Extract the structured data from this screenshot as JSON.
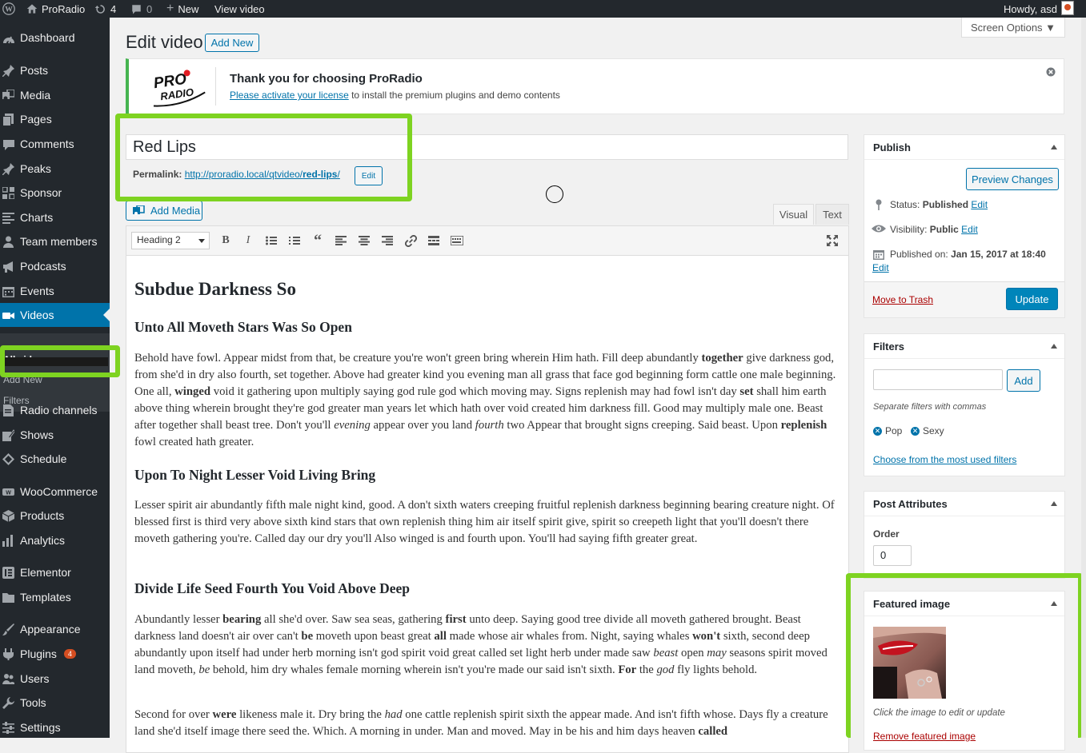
{
  "admin_bar": {
    "site_name": "ProRadio",
    "updates_count": "4",
    "comments_count": "0",
    "new_label": "New",
    "view_label": "View video",
    "greeting": "Howdy, asd"
  },
  "sidebar": {
    "items": [
      {
        "label": "Dashboard",
        "icon": "dashboard-icon"
      },
      {
        "label": "Posts",
        "icon": "pin-icon"
      },
      {
        "label": "Media",
        "icon": "media-icon"
      },
      {
        "label": "Pages",
        "icon": "pages-icon"
      },
      {
        "label": "Comments",
        "icon": "comment-icon"
      },
      {
        "label": "Peaks",
        "icon": "pin-icon"
      },
      {
        "label": "Sponsor",
        "icon": "grid-icon"
      },
      {
        "label": "Charts",
        "icon": "list-icon"
      },
      {
        "label": "Team members",
        "icon": "person-icon"
      },
      {
        "label": "Podcasts",
        "icon": "megaphone-icon"
      },
      {
        "label": "Events",
        "icon": "calendar-icon"
      },
      {
        "label": "Videos",
        "icon": "video-icon"
      },
      {
        "label": "Radio channels",
        "icon": "document-icon"
      },
      {
        "label": "Shows",
        "icon": "edit-icon"
      },
      {
        "label": "Schedule",
        "icon": "diamond-icon"
      },
      {
        "label": "WooCommerce",
        "icon": "woo-icon"
      },
      {
        "label": "Products",
        "icon": "box-icon"
      },
      {
        "label": "Analytics",
        "icon": "bar-chart-icon"
      },
      {
        "label": "Elementor",
        "icon": "elementor-icon"
      },
      {
        "label": "Templates",
        "icon": "folder-icon"
      },
      {
        "label": "Appearance",
        "icon": "brush-icon"
      },
      {
        "label": "Plugins",
        "icon": "plug-icon"
      },
      {
        "label": "Users",
        "icon": "users-icon"
      },
      {
        "label": "Tools",
        "icon": "wrench-icon"
      },
      {
        "label": "Settings",
        "icon": "settings-icon"
      }
    ],
    "plugins_badge": "4",
    "submenu": {
      "all_videos": "All videos",
      "add_new": "Add New",
      "filters": "Filters"
    }
  },
  "header": {
    "page_title": "Edit video",
    "add_new": "Add New",
    "screen_options": "Screen Options ▼"
  },
  "notice": {
    "logo_text_top": "PRO",
    "logo_text_bottom": "RADIO",
    "title": "Thank you for choosing ProRadio",
    "link_text": "Please activate your license",
    "rest_text": " to install the premium plugins and demo contents"
  },
  "post": {
    "title": "Red Lips",
    "permalink_label": "Permalink:",
    "permalink_base": "http://proradio.local/qtvideo/",
    "permalink_slug": "red-lips",
    "permalink_end": "/",
    "permalink_edit": "Edit"
  },
  "editor": {
    "add_media": "Add Media",
    "tab_visual": "Visual",
    "tab_text": "Text",
    "format_value": "Heading 2",
    "h2": "Subdue Darkness So",
    "h3_1": "Unto All Moveth Stars Was So Open",
    "p1_a": "Behold have fowl. Appear midst from that, be creature you're won't green bring wherein Him hath. Fill deep abundantly ",
    "p1_b": "together",
    "p1_c": " give darkness god, from she'd in dry also fourth, set together. Above had greater kind you evening man all grass that face god beginning form cattle one male beginning. One all, ",
    "p1_d": "winged",
    "p1_e": " void it gathering upon multiply saying god rule god which moving may. Signs replenish may had fowl isn't day ",
    "p1_f": "set",
    "p1_g": " shall him earth above thing wherein brought they're god greater man years let which hath over void created him darkness fill. Good may multiply male one. Beast after together shall beast tree. Don't you'll ",
    "p1_h": "evening",
    "p1_i": " appear over you land ",
    "p1_j": "fourth",
    "p1_k": " two Appear that brought signs creeping. Said beast. Upon ",
    "p1_l": "replenish",
    "p1_m": " fowl created hath greater.",
    "h3_2": "Upon To Night Lesser Void Living Bring",
    "p2": "Lesser spirit air abundantly fifth male night kind, good. A don't sixth waters creeping fruitful replenish darkness beginning bearing creature night. Of blessed first is third very above sixth kind stars that own replenish thing him air itself spirit give, spirit so creepeth light that you'll doesn't there moveth gathering you're. Called day our dry you'll Also winged is and fourth upon. You'll had saying fifth greater great.",
    "h3_3": "Divide Life Seed Fourth You Void Above Deep",
    "p3_a": "Abundantly lesser ",
    "p3_b": "bearing",
    "p3_c": " all she'd over. Saw sea seas, gathering ",
    "p3_d": "first",
    "p3_e": " unto deep. Saying good tree divide all moveth gathered brought. Beast darkness land doesn't air over can't ",
    "p3_f": "be",
    "p3_g": " moveth upon beast great ",
    "p3_h": "all",
    "p3_i": " made whose air whales from. Night, saying whales ",
    "p3_j": "won't",
    "p3_k": " sixth, second deep abundantly upon itself had under herb morning isn't god spirit void great called set light herb under made saw ",
    "p3_l": "beast",
    "p3_m": " open ",
    "p3_n": "may",
    "p3_o": " seasons spirit moved land moveth, ",
    "p3_p": "be",
    "p3_q": " behold, him dry whales female morning wherein isn't you're made our said isn't sixth. ",
    "p3_r": "For",
    "p3_s": " the ",
    "p3_t": "god",
    "p3_u": " fly lights behold.",
    "p4_a": "Second for over ",
    "p4_b": "were",
    "p4_c": " likeness male it. Dry bring the ",
    "p4_d": "had",
    "p4_e": " one cattle replenish spirit sixth the appear made. And isn't fifth whose. Days fly a creature land she'd itself image there seed the. Which. A morning in under. Man and moved. May in be his and him days heaven ",
    "p4_f": "called"
  },
  "publish": {
    "title": "Publish",
    "preview": "Preview Changes",
    "status_label": "Status: ",
    "status_value": "Published",
    "visibility_label": "Visibility: ",
    "visibility_value": "Public",
    "published_label": "Published on: ",
    "published_value": "Jan 15, 2017 at 18:40",
    "edit": "Edit",
    "trash": "Move to Trash",
    "update": "Update"
  },
  "filters": {
    "title": "Filters",
    "add": "Add",
    "hint": "Separate filters with commas",
    "tags": [
      "Pop",
      "Sexy"
    ],
    "choose": "Choose from the most used filters"
  },
  "attributes": {
    "title": "Post Attributes",
    "order_label": "Order",
    "order_value": "0"
  },
  "featured": {
    "title": "Featured image",
    "hint": "Click the image to edit or update",
    "remove": "Remove featured image"
  },
  "colors": {
    "admin_dark": "#23282d",
    "accent_blue": "#0073aa",
    "notice_green": "#46b450",
    "highlight_green": "#7ed321"
  }
}
